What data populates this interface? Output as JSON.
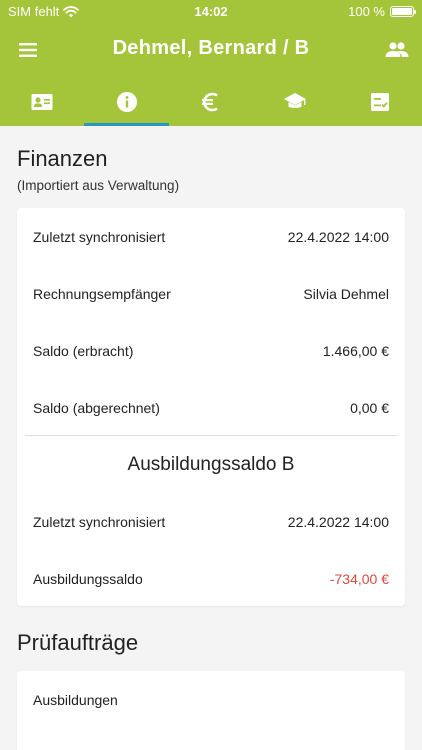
{
  "status": {
    "carrier": "SIM fehlt",
    "time": "14:02",
    "battery": "100 %",
    "battery_level": 1.0
  },
  "appbar": {
    "title": "Dehmel, Bernard / B"
  },
  "tabs": [
    {
      "icon": "contact-card-icon",
      "active": false
    },
    {
      "icon": "info-icon",
      "active": true
    },
    {
      "icon": "euro-icon",
      "active": false
    },
    {
      "icon": "graduation-cap-icon",
      "active": false
    },
    {
      "icon": "checklist-icon",
      "active": false
    }
  ],
  "colors": {
    "header": "#a4c43a",
    "tab_indicator": "#2a95c8",
    "negative": "#e0463c"
  },
  "finanzen": {
    "title": "Finanzen",
    "subtitle": "(Importiert aus Verwaltung)",
    "rows": [
      {
        "label": "Zuletzt synchronisiert",
        "value": "22.4.2022 14:00"
      },
      {
        "label": "Rechnungsempfänger",
        "value": "Silvia Dehmel"
      },
      {
        "label": "Saldo (erbracht)",
        "value": "1.466,00 €"
      },
      {
        "label": "Saldo (abgerechnet)",
        "value": "0,00 €"
      }
    ],
    "ausbildung": {
      "heading": "Ausbildungssaldo B",
      "rows": [
        {
          "label": "Zuletzt synchronisiert",
          "value": "22.4.2022 14:00"
        },
        {
          "label": "Ausbildungssaldo",
          "value": "-734,00 €"
        }
      ]
    }
  },
  "pruefauftraege": {
    "title": "Prüfaufträge",
    "items": [
      {
        "label": "Ausbildungen"
      }
    ]
  }
}
